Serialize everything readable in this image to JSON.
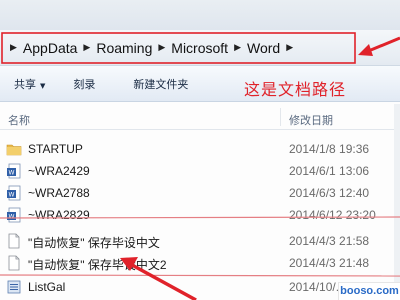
{
  "address_bar": {
    "crumbs": [
      "AppData",
      "Roaming",
      "Microsoft",
      "Word"
    ]
  },
  "toolbar": {
    "share_label": "共享",
    "burn_label": "刻录",
    "new_folder_label": "新建文件夹"
  },
  "annotation": {
    "path_text": "这是文档路径"
  },
  "columns": {
    "name": "名称",
    "modified": "修改日期"
  },
  "files": [
    {
      "name": "STARTUP",
      "date": "2014/1/8 19:36",
      "icon": "folder-icon"
    },
    {
      "name": "~WRA2429",
      "date": "2014/6/1 13:06",
      "icon": "word-document-icon"
    },
    {
      "name": "~WRA2788",
      "date": "2014/6/3 12:40",
      "icon": "word-document-icon"
    },
    {
      "name": "~WRA2829",
      "date": "2014/6/12 23:20",
      "icon": "word-document-icon"
    },
    {
      "name": "\"自动恢复\" 保存毕设中文",
      "date": "2014/4/3 21:58",
      "icon": "blank-file-icon"
    },
    {
      "name": "\"自动恢复\" 保存毕设中文2",
      "date": "2014/4/3 21:48",
      "icon": "blank-file-icon"
    },
    {
      "name": "ListGal",
      "date": "2014/10/...",
      "icon": "list-file-icon"
    }
  ],
  "watermark": {
    "text": "booso.com"
  },
  "colors": {
    "annotation_red": "#e0222a",
    "folder_yellow": "#e8b84a",
    "word_blue": "#2f5fa8"
  }
}
